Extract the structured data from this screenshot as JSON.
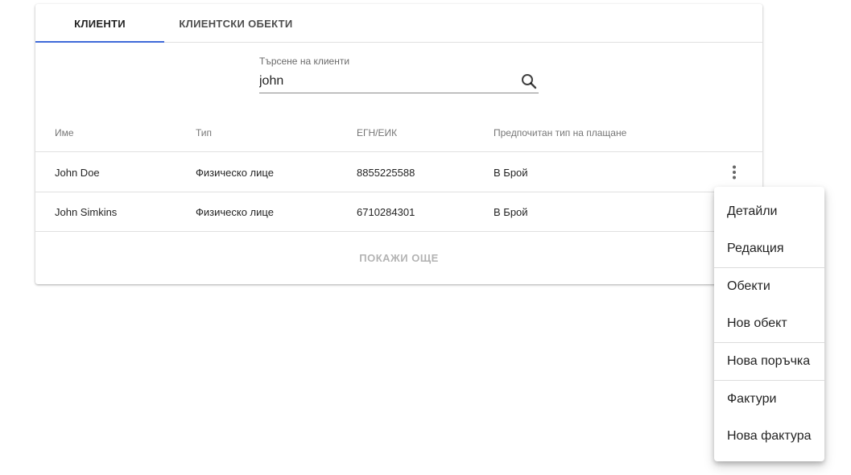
{
  "tabs": [
    {
      "label": "КЛИЕНТИ",
      "active": true
    },
    {
      "label": "КЛИЕНТСКИ ОБЕКТИ",
      "active": false
    }
  ],
  "search": {
    "label": "Търсене на клиенти",
    "value": "john",
    "icon": "search-icon"
  },
  "table": {
    "columns": [
      "Име",
      "Тип",
      "ЕГН/ЕИК",
      "Предпочитан тип на плащане"
    ],
    "rows": [
      [
        "John Doe",
        "Физическо лице",
        "8855225588",
        "В Брой"
      ],
      [
        "John Simkins",
        "Физическо лице",
        "6710284301",
        "В Брой"
      ]
    ]
  },
  "show_more_label": "ПОКАЖИ ОЩЕ",
  "menu": {
    "items": [
      "Детайли",
      "Редакция",
      "Обекти",
      "Нов обект",
      "Нова поръчка",
      "Фактури",
      "Нова фактура"
    ]
  },
  "colors": {
    "accent": "#3f6ad8",
    "divider": "#e0e0e0"
  }
}
